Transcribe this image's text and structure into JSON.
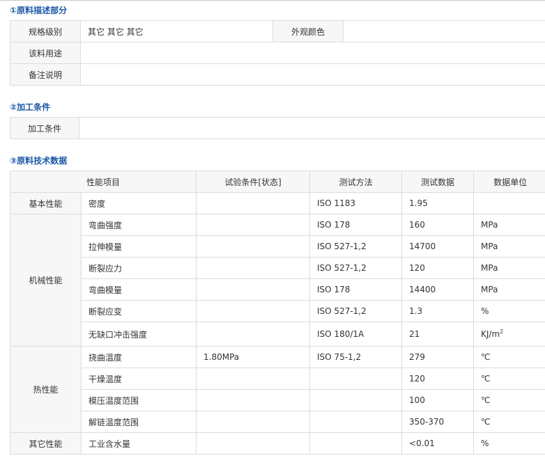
{
  "sections": {
    "desc_title": "①原料描述部分",
    "process_title": "②加工条件",
    "tech_title": "③原料技术数据"
  },
  "desc": {
    "spec_label": "规格级别",
    "spec_value": "其它 其它 其它",
    "color_label": "外观颜色",
    "color_value": "",
    "use_label": "该料用途",
    "use_value": "",
    "note_label": "备注说明",
    "note_value": ""
  },
  "process": {
    "label": "加工条件",
    "value": ""
  },
  "tech": {
    "headers": {
      "property": "性能项目",
      "condition": "试验条件[状态]",
      "method": "测试方法",
      "data": "测试数据",
      "unit": "数据单位"
    },
    "groups": [
      {
        "name": "基本性能",
        "rows": [
          {
            "item": "密度",
            "condition": "",
            "method": "ISO 1183",
            "value": "1.95",
            "unit": ""
          }
        ]
      },
      {
        "name": "机械性能",
        "rows": [
          {
            "item": "弯曲强度",
            "condition": "",
            "method": "ISO 178",
            "value": "160",
            "unit": "MPa"
          },
          {
            "item": "拉伸模量",
            "condition": "",
            "method": "ISO 527-1,2",
            "value": "14700",
            "unit": "MPa"
          },
          {
            "item": "断裂应力",
            "condition": "",
            "method": "ISO 527-1,2",
            "value": "120",
            "unit": "MPa"
          },
          {
            "item": "弯曲模量",
            "condition": "",
            "method": "ISO 178",
            "value": "14400",
            "unit": "MPa"
          },
          {
            "item": "断裂应变",
            "condition": "",
            "method": "ISO 527-1,2",
            "value": "1.3",
            "unit": "%"
          },
          {
            "item": "无缺口冲击强度",
            "condition": "",
            "method": "ISO 180/1A",
            "value": "21",
            "unit": "KJ/m",
            "unit_sup": "2"
          }
        ]
      },
      {
        "name": "热性能",
        "rows": [
          {
            "item": "挠曲温度",
            "condition": "1.80MPa",
            "method": "ISO 75-1,2",
            "value": "279",
            "unit": "℃"
          },
          {
            "item": "干燥温度",
            "condition": "",
            "method": "",
            "value": "120",
            "unit": "℃"
          },
          {
            "item": "模压温度范围",
            "condition": "",
            "method": "",
            "value": "100",
            "unit": "℃"
          },
          {
            "item": "解链温度范围",
            "condition": "",
            "method": "",
            "value": "350-370",
            "unit": "℃"
          }
        ]
      },
      {
        "name": "其它性能",
        "rows": [
          {
            "item": "工业含水量",
            "condition": "",
            "method": "",
            "value": "<0.01",
            "unit": "%"
          }
        ]
      }
    ]
  }
}
